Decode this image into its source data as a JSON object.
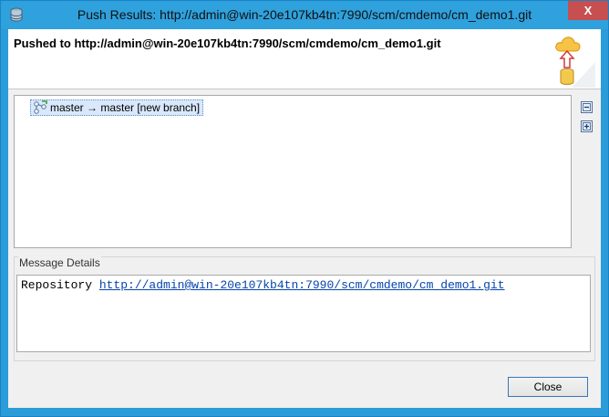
{
  "window": {
    "title": "Push Results: http://admin@win-20e107kb4tn:7990/scm/cmdemo/cm_demo1.git",
    "close_glyph": "X"
  },
  "header": {
    "message": "Pushed to http://admin@win-20e107kb4tn:7990/scm/cmdemo/cm_demo1.git",
    "banner_icon": "cloud-push-banner-icon"
  },
  "tree": {
    "items": [
      {
        "label": "master → master [new branch]",
        "icon": "branch-push-icon"
      }
    ],
    "collapse_icon": "collapse-all-icon",
    "expand_icon": "expand-all-icon"
  },
  "details": {
    "label": "Message Details",
    "prefix": "Repository ",
    "link": "http://admin@win-20e107kb4tn:7990/scm/cmdemo/cm_demo1.git"
  },
  "buttons": {
    "close": "Close"
  },
  "colors": {
    "titlebar": "#2fa1dd",
    "close_box": "#c74f4f",
    "link": "#0645ad"
  }
}
